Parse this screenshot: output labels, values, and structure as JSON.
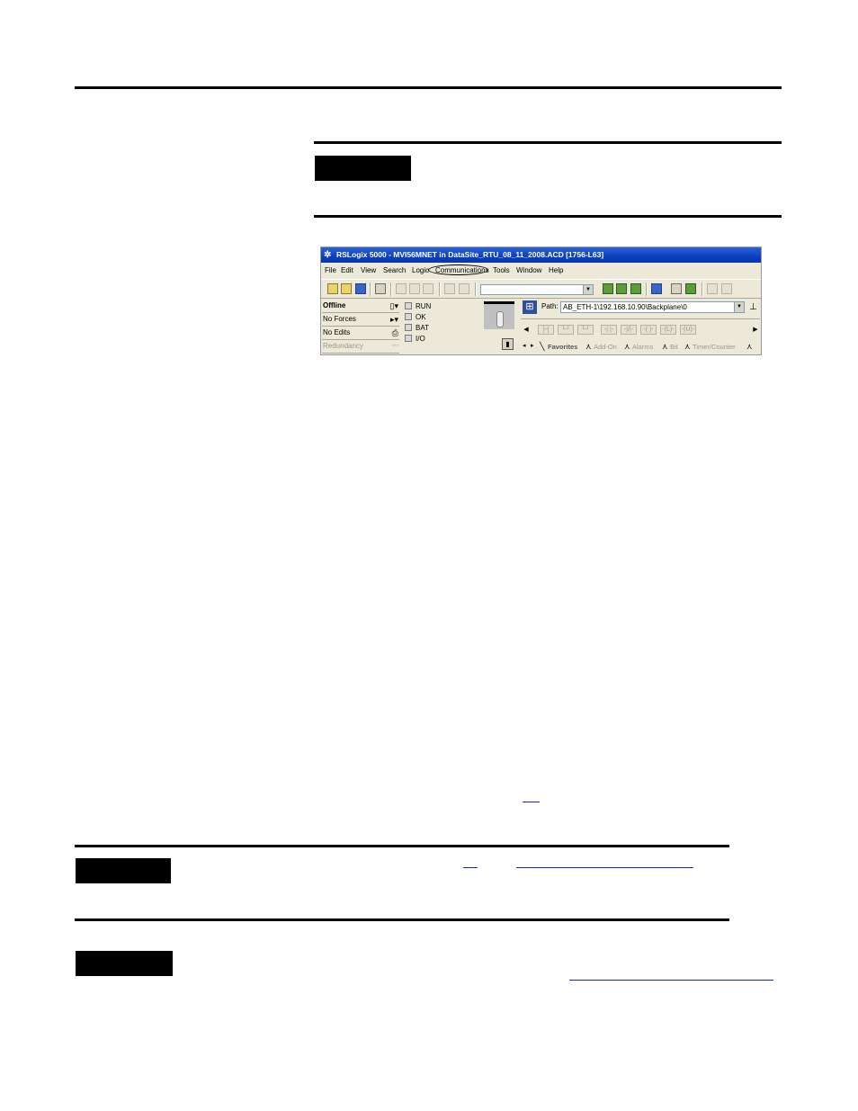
{
  "window": {
    "title": "RSLogix 5000 - MVI56MNET in DataSite_RTU_08_11_2008.ACD [1756-L63]",
    "menu": [
      "File",
      "Edit",
      "View",
      "Search",
      "Logic",
      "Communications",
      "Tools",
      "Window",
      "Help"
    ],
    "highlighted_menu": "Communications"
  },
  "status": {
    "items": [
      {
        "label": "Offline"
      },
      {
        "label": "No Forces"
      },
      {
        "label": "No Edits"
      },
      {
        "label": "Redundancy"
      }
    ],
    "lights": [
      "RUN",
      "OK",
      "BAT",
      "I/O"
    ]
  },
  "path": {
    "label": "Path:",
    "value": "AB_ETH-1\\192.168.10.90\\Backplane\\0"
  },
  "tabs": [
    "Favorites",
    "Add-On",
    "Alarms",
    "Bit",
    "Timer/Counter"
  ],
  "icons": {
    "app": "rslogix-app-icon",
    "network": "network-path-icon"
  }
}
